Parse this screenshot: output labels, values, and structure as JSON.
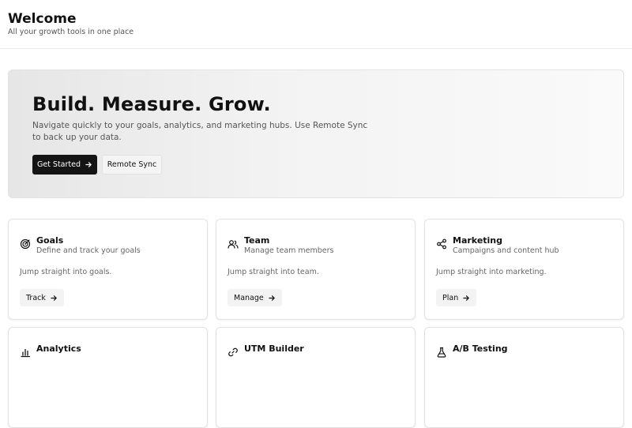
{
  "header": {
    "title": "Welcome",
    "subtitle": "All your growth tools in one place"
  },
  "hero": {
    "headline": "Build. Measure. Grow.",
    "description": "Navigate quickly to your goals, analytics, and marketing hubs. Use Remote Sync to back up your data.",
    "primary_button": "Get Started",
    "secondary_button": "Remote Sync"
  },
  "cards": [
    {
      "title": "Goals",
      "subtitle": "Define and track your goals",
      "body": "Jump straight into goals.",
      "button": "Track",
      "icon": "target-icon"
    },
    {
      "title": "Team",
      "subtitle": "Manage team members",
      "body": "Jump straight into team.",
      "button": "Manage",
      "icon": "users-icon"
    },
    {
      "title": "Marketing",
      "subtitle": "Campaigns and content hub",
      "body": "Jump straight into marketing.",
      "button": "Plan",
      "icon": "share-icon"
    },
    {
      "title": "Analytics",
      "icon": "bar-chart-icon"
    },
    {
      "title": "UTM Builder",
      "icon": "link-icon"
    },
    {
      "title": "A/B Testing",
      "icon": "flask-icon"
    }
  ],
  "colors": {
    "primary": "#141414",
    "border": "#e2e2e2",
    "muted_text": "#666666"
  }
}
